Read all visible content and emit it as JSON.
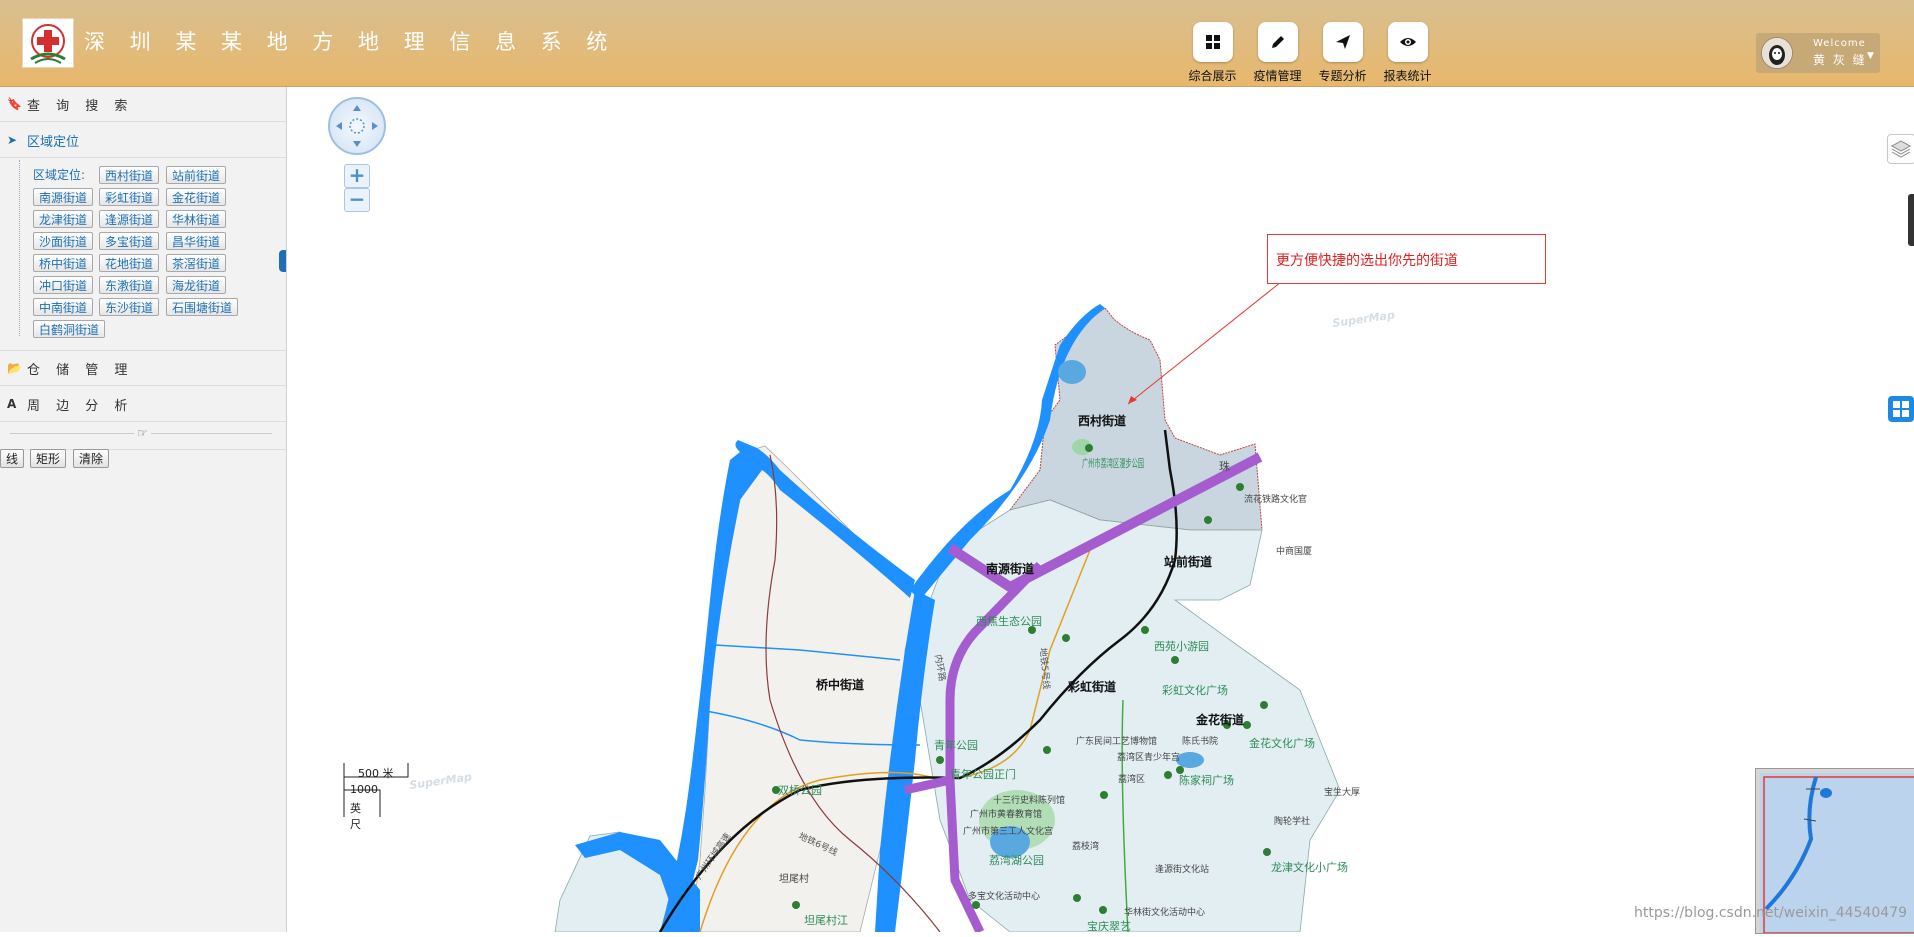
{
  "header": {
    "title": "深 圳 某 某 地 方 地 理 信 息 系 统",
    "nav": [
      {
        "label": "综合展示",
        "icon": "grid-icon"
      },
      {
        "label": "疫情管理",
        "icon": "pencil-icon"
      },
      {
        "label": "专题分析",
        "icon": "send-icon"
      },
      {
        "label": "报表统计",
        "icon": "eye-icon"
      }
    ],
    "user": {
      "welcome": "Welcome",
      "name": "黄 灰 缝"
    }
  },
  "sidebar": {
    "sections": {
      "query": "查 询 搜 索",
      "region": "区域定位",
      "storage": "仓 储 管 理",
      "surround": "周 边 分 析"
    },
    "region_label": "区域定位:",
    "streets": [
      "西村街道",
      "站前街道",
      "南源街道",
      "彩虹街道",
      "金花街道",
      "龙津街道",
      "逢源街道",
      "华林街道",
      "沙面街道",
      "多宝街道",
      "昌华街道",
      "桥中街道",
      "花地街道",
      "茶滘街道",
      "冲口街道",
      "东漖街道",
      "海龙街道",
      "中南街道",
      "东沙街道",
      "石围塘街道",
      "白鹤洞街道"
    ],
    "tools": [
      "线",
      "矩形",
      "清除"
    ]
  },
  "map": {
    "zoom_in": "+",
    "zoom_out": "−",
    "scale": {
      "metric": "500 米",
      "imperial_value": "1000",
      "imperial_unit": "英尺"
    },
    "annotation": "更方便快捷的选出你先的街道",
    "supermap": "SuperMap",
    "streets": [
      "西村街道",
      "南源街道",
      "站前街道",
      "桥中街道",
      "彩虹街道",
      "金花街道"
    ],
    "pois": [
      "广州市荔湾区漫步公园",
      "流花铁路文化官",
      "中商国厦",
      "西焦生态公园",
      "西苑小游园",
      "彩虹文化广场",
      "金花文化广场",
      "青年公园",
      "青年公园正门",
      "广东民间工艺博物馆",
      "陈氏书院",
      "荔湾区青少年宫",
      "荔湾区",
      "陈家祠广场",
      "双桥公园",
      "十三行史料陈列馆",
      "广州市黄春教育馆",
      "广州市第三工人文化宫",
      "荔枝湾",
      "荔湾湖公园",
      "逢源街文化站",
      "龙津文化小广场",
      "多宝文化活动中心",
      "华林街文化活动中心",
      "宝庆翠艺",
      "坦尾村",
      "坦尾村江",
      "宝生大厚",
      "陶轮学社",
      "内环路",
      "广州环城高速",
      "地铁5号线",
      "地铁6号线",
      "珠"
    ],
    "watermark": "https://blog.csdn.net/weixin_44540479"
  },
  "colors": {
    "header_start": "#d8bf90",
    "header_end": "#e8b76c",
    "river": "#1e90ff",
    "metro": "#a45ccf",
    "link": "#1f6fb4",
    "annotation": "#e02020"
  }
}
